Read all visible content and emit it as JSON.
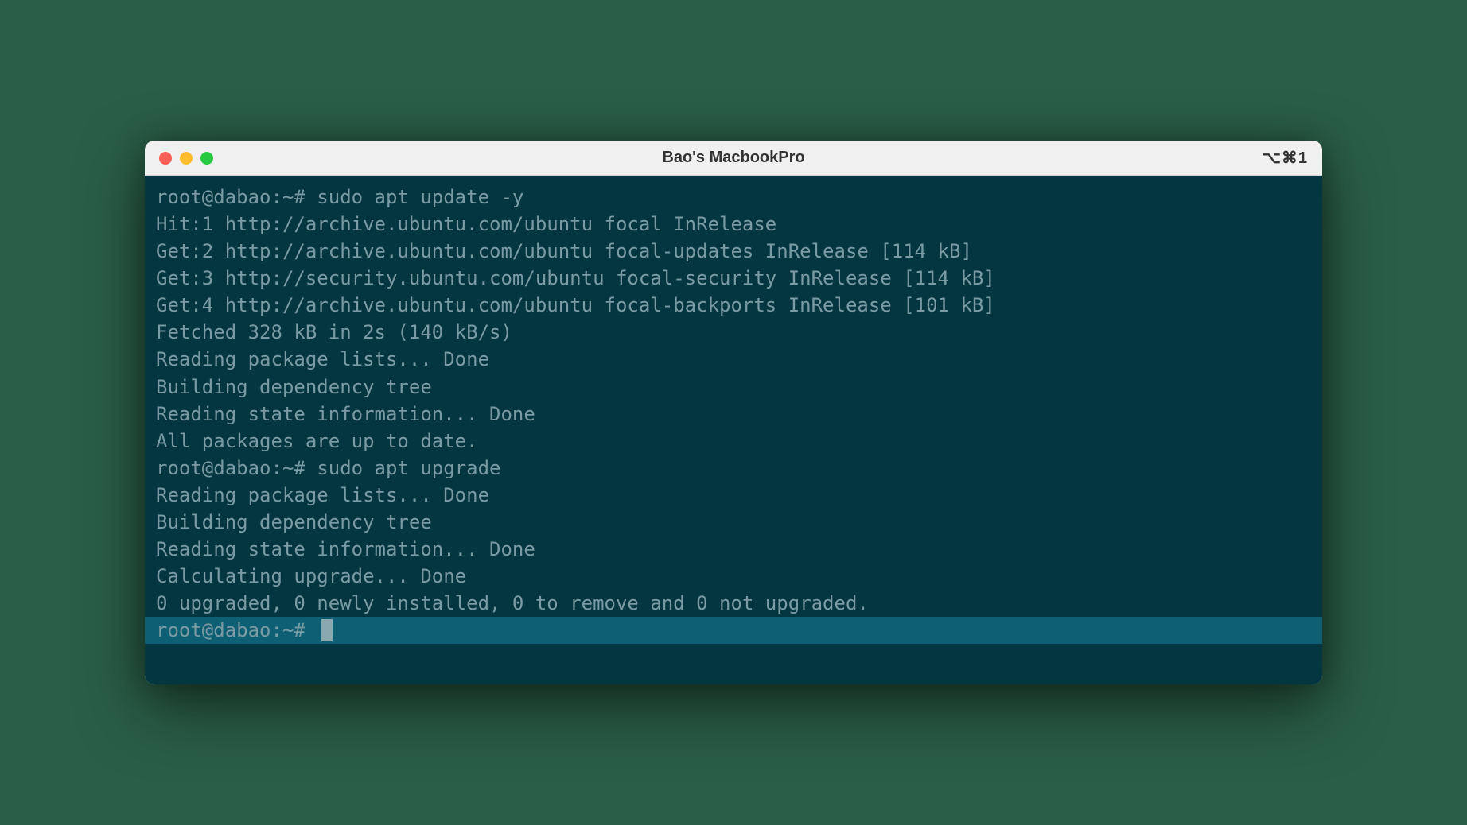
{
  "window": {
    "title": "Bao's MacbookPro",
    "shortcut": "⌥⌘1"
  },
  "terminal": {
    "lines": [
      "root@dabao:~# sudo apt update -y",
      "Hit:1 http://archive.ubuntu.com/ubuntu focal InRelease",
      "Get:2 http://archive.ubuntu.com/ubuntu focal-updates InRelease [114 kB]",
      "Get:3 http://security.ubuntu.com/ubuntu focal-security InRelease [114 kB]",
      "Get:4 http://archive.ubuntu.com/ubuntu focal-backports InRelease [101 kB]",
      "Fetched 328 kB in 2s (140 kB/s)",
      "Reading package lists... Done",
      "Building dependency tree",
      "Reading state information... Done",
      "All packages are up to date.",
      "root@dabao:~# sudo apt upgrade",
      "Reading package lists... Done",
      "Building dependency tree",
      "Reading state information... Done",
      "Calculating upgrade... Done",
      "0 upgraded, 0 newly installed, 0 to remove and 0 not upgraded."
    ],
    "active_prompt": "root@dabao:~# "
  }
}
